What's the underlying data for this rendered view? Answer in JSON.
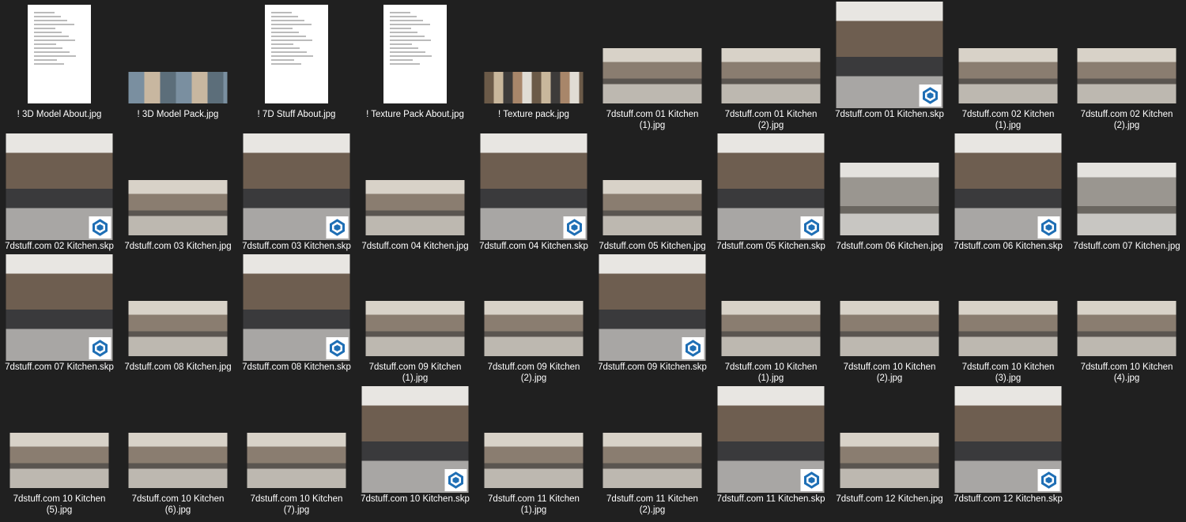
{
  "files": [
    {
      "name": "! 3D Model About.jpg",
      "type": "jpg"
    },
    {
      "name": "! 3D Model Pack.jpg",
      "type": "jpg"
    },
    {
      "name": "! 7D Stuff About.jpg",
      "type": "jpg"
    },
    {
      "name": "! Texture Pack About.jpg",
      "type": "jpg"
    },
    {
      "name": "! Texture pack.jpg",
      "type": "jpg"
    },
    {
      "name": "7dstuff.com 01 Kitchen (1).jpg",
      "type": "jpg"
    },
    {
      "name": "7dstuff.com 01 Kitchen (2).jpg",
      "type": "jpg"
    },
    {
      "name": "7dstuff.com 01 Kitchen.skp",
      "type": "skp"
    },
    {
      "name": "7dstuff.com 02 Kitchen (1).jpg",
      "type": "jpg"
    },
    {
      "name": "7dstuff.com 02 Kitchen (2).jpg",
      "type": "jpg"
    },
    {
      "name": "7dstuff.com 02 Kitchen.skp",
      "type": "skp"
    },
    {
      "name": "7dstuff.com 03 Kitchen.jpg",
      "type": "jpg"
    },
    {
      "name": "7dstuff.com 03 Kitchen.skp",
      "type": "skp"
    },
    {
      "name": "7dstuff.com 04 Kitchen.jpg",
      "type": "jpg"
    },
    {
      "name": "7dstuff.com 04 Kitchen.skp",
      "type": "skp"
    },
    {
      "name": "7dstuff.com 05 Kitchen.jpg",
      "type": "jpg"
    },
    {
      "name": "7dstuff.com 05 Kitchen.skp",
      "type": "skp"
    },
    {
      "name": "7dstuff.com 06 Kitchen.jpg",
      "type": "jpg"
    },
    {
      "name": "7dstuff.com 06 Kitchen.skp",
      "type": "skp"
    },
    {
      "name": "7dstuff.com 07 Kitchen.jpg",
      "type": "jpg"
    },
    {
      "name": "7dstuff.com 07 Kitchen.skp",
      "type": "skp"
    },
    {
      "name": "7dstuff.com 08 Kitchen.jpg",
      "type": "jpg"
    },
    {
      "name": "7dstuff.com 08 Kitchen.skp",
      "type": "skp"
    },
    {
      "name": "7dstuff.com 09 Kitchen (1).jpg",
      "type": "jpg"
    },
    {
      "name": "7dstuff.com 09 Kitchen (2).jpg",
      "type": "jpg"
    },
    {
      "name": "7dstuff.com 09 Kitchen.skp",
      "type": "skp"
    },
    {
      "name": "7dstuff.com 10 Kitchen (1).jpg",
      "type": "jpg"
    },
    {
      "name": "7dstuff.com 10 Kitchen (2).jpg",
      "type": "jpg"
    },
    {
      "name": "7dstuff.com 10 Kitchen (3).jpg",
      "type": "jpg"
    },
    {
      "name": "7dstuff.com 10 Kitchen (4).jpg",
      "type": "jpg"
    },
    {
      "name": "7dstuff.com 10 Kitchen (5).jpg",
      "type": "jpg"
    },
    {
      "name": "7dstuff.com 10 Kitchen (6).jpg",
      "type": "jpg"
    },
    {
      "name": "7dstuff.com 10 Kitchen (7).jpg",
      "type": "jpg"
    },
    {
      "name": "7dstuff.com 10 Kitchen.skp",
      "type": "skp"
    },
    {
      "name": "7dstuff.com 11 Kitchen (1).jpg",
      "type": "jpg"
    },
    {
      "name": "7dstuff.com 11 Kitchen (2).jpg",
      "type": "jpg"
    },
    {
      "name": "7dstuff.com 11 Kitchen.skp",
      "type": "skp"
    },
    {
      "name": "7dstuff.com 12 Kitchen.jpg",
      "type": "jpg"
    },
    {
      "name": "7dstuff.com 12 Kitchen.skp",
      "type": "skp"
    }
  ],
  "colors": {
    "background": "#202020",
    "sketchup_badge": "#1f6fb5"
  }
}
